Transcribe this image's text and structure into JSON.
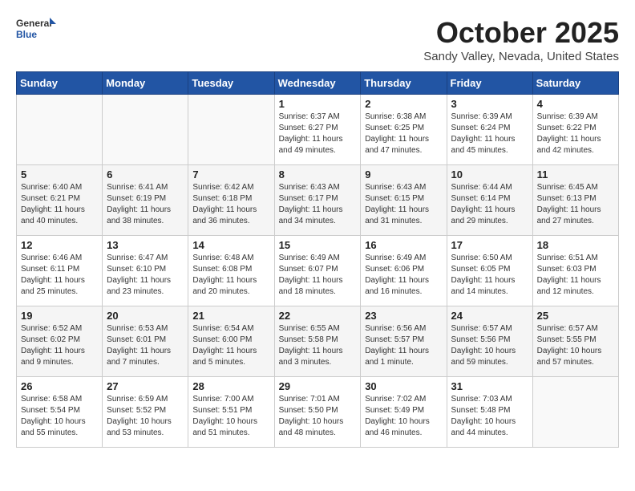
{
  "header": {
    "logo_general": "General",
    "logo_blue": "Blue",
    "month": "October 2025",
    "location": "Sandy Valley, Nevada, United States"
  },
  "weekdays": [
    "Sunday",
    "Monday",
    "Tuesday",
    "Wednesday",
    "Thursday",
    "Friday",
    "Saturday"
  ],
  "weeks": [
    [
      {
        "day": "",
        "info": ""
      },
      {
        "day": "",
        "info": ""
      },
      {
        "day": "",
        "info": ""
      },
      {
        "day": "1",
        "info": "Sunrise: 6:37 AM\nSunset: 6:27 PM\nDaylight: 11 hours\nand 49 minutes."
      },
      {
        "day": "2",
        "info": "Sunrise: 6:38 AM\nSunset: 6:25 PM\nDaylight: 11 hours\nand 47 minutes."
      },
      {
        "day": "3",
        "info": "Sunrise: 6:39 AM\nSunset: 6:24 PM\nDaylight: 11 hours\nand 45 minutes."
      },
      {
        "day": "4",
        "info": "Sunrise: 6:39 AM\nSunset: 6:22 PM\nDaylight: 11 hours\nand 42 minutes."
      }
    ],
    [
      {
        "day": "5",
        "info": "Sunrise: 6:40 AM\nSunset: 6:21 PM\nDaylight: 11 hours\nand 40 minutes."
      },
      {
        "day": "6",
        "info": "Sunrise: 6:41 AM\nSunset: 6:19 PM\nDaylight: 11 hours\nand 38 minutes."
      },
      {
        "day": "7",
        "info": "Sunrise: 6:42 AM\nSunset: 6:18 PM\nDaylight: 11 hours\nand 36 minutes."
      },
      {
        "day": "8",
        "info": "Sunrise: 6:43 AM\nSunset: 6:17 PM\nDaylight: 11 hours\nand 34 minutes."
      },
      {
        "day": "9",
        "info": "Sunrise: 6:43 AM\nSunset: 6:15 PM\nDaylight: 11 hours\nand 31 minutes."
      },
      {
        "day": "10",
        "info": "Sunrise: 6:44 AM\nSunset: 6:14 PM\nDaylight: 11 hours\nand 29 minutes."
      },
      {
        "day": "11",
        "info": "Sunrise: 6:45 AM\nSunset: 6:13 PM\nDaylight: 11 hours\nand 27 minutes."
      }
    ],
    [
      {
        "day": "12",
        "info": "Sunrise: 6:46 AM\nSunset: 6:11 PM\nDaylight: 11 hours\nand 25 minutes."
      },
      {
        "day": "13",
        "info": "Sunrise: 6:47 AM\nSunset: 6:10 PM\nDaylight: 11 hours\nand 23 minutes."
      },
      {
        "day": "14",
        "info": "Sunrise: 6:48 AM\nSunset: 6:08 PM\nDaylight: 11 hours\nand 20 minutes."
      },
      {
        "day": "15",
        "info": "Sunrise: 6:49 AM\nSunset: 6:07 PM\nDaylight: 11 hours\nand 18 minutes."
      },
      {
        "day": "16",
        "info": "Sunrise: 6:49 AM\nSunset: 6:06 PM\nDaylight: 11 hours\nand 16 minutes."
      },
      {
        "day": "17",
        "info": "Sunrise: 6:50 AM\nSunset: 6:05 PM\nDaylight: 11 hours\nand 14 minutes."
      },
      {
        "day": "18",
        "info": "Sunrise: 6:51 AM\nSunset: 6:03 PM\nDaylight: 11 hours\nand 12 minutes."
      }
    ],
    [
      {
        "day": "19",
        "info": "Sunrise: 6:52 AM\nSunset: 6:02 PM\nDaylight: 11 hours\nand 9 minutes."
      },
      {
        "day": "20",
        "info": "Sunrise: 6:53 AM\nSunset: 6:01 PM\nDaylight: 11 hours\nand 7 minutes."
      },
      {
        "day": "21",
        "info": "Sunrise: 6:54 AM\nSunset: 6:00 PM\nDaylight: 11 hours\nand 5 minutes."
      },
      {
        "day": "22",
        "info": "Sunrise: 6:55 AM\nSunset: 5:58 PM\nDaylight: 11 hours\nand 3 minutes."
      },
      {
        "day": "23",
        "info": "Sunrise: 6:56 AM\nSunset: 5:57 PM\nDaylight: 11 hours\nand 1 minute."
      },
      {
        "day": "24",
        "info": "Sunrise: 6:57 AM\nSunset: 5:56 PM\nDaylight: 10 hours\nand 59 minutes."
      },
      {
        "day": "25",
        "info": "Sunrise: 6:57 AM\nSunset: 5:55 PM\nDaylight: 10 hours\nand 57 minutes."
      }
    ],
    [
      {
        "day": "26",
        "info": "Sunrise: 6:58 AM\nSunset: 5:54 PM\nDaylight: 10 hours\nand 55 minutes."
      },
      {
        "day": "27",
        "info": "Sunrise: 6:59 AM\nSunset: 5:52 PM\nDaylight: 10 hours\nand 53 minutes."
      },
      {
        "day": "28",
        "info": "Sunrise: 7:00 AM\nSunset: 5:51 PM\nDaylight: 10 hours\nand 51 minutes."
      },
      {
        "day": "29",
        "info": "Sunrise: 7:01 AM\nSunset: 5:50 PM\nDaylight: 10 hours\nand 48 minutes."
      },
      {
        "day": "30",
        "info": "Sunrise: 7:02 AM\nSunset: 5:49 PM\nDaylight: 10 hours\nand 46 minutes."
      },
      {
        "day": "31",
        "info": "Sunrise: 7:03 AM\nSunset: 5:48 PM\nDaylight: 10 hours\nand 44 minutes."
      },
      {
        "day": "",
        "info": ""
      }
    ]
  ]
}
